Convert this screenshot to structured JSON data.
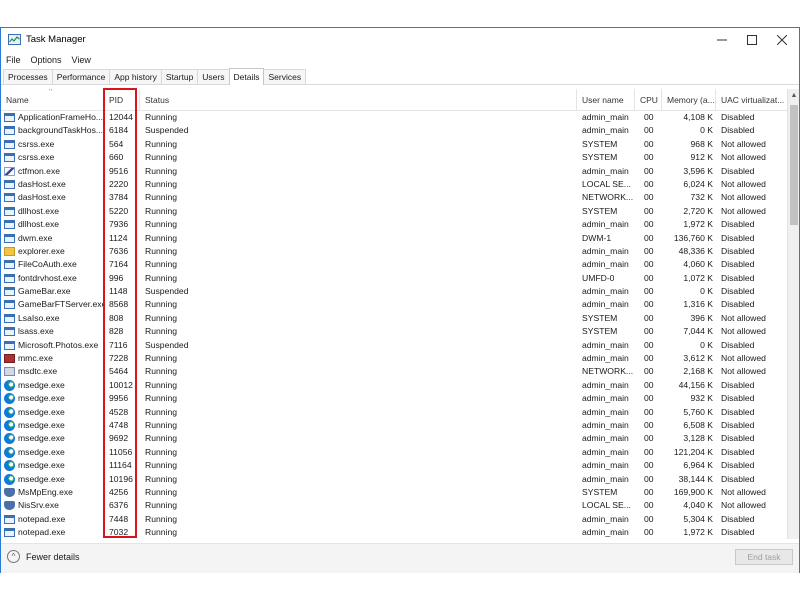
{
  "window": {
    "title": "Task Manager"
  },
  "menu": [
    "File",
    "Options",
    "View"
  ],
  "tabs": [
    "Processes",
    "Performance",
    "App history",
    "Startup",
    "Users",
    "Details",
    "Services"
  ],
  "active_tab": "Details",
  "columns": {
    "name": "Name",
    "pid": "PID",
    "status": "Status",
    "user": "User name",
    "cpu": "CPU",
    "memory": "Memory (a...",
    "uac": "UAC virtualizat..."
  },
  "rows": [
    {
      "name": "ApplicationFrameHo...",
      "pid": "12044",
      "status": "Running",
      "user": "admin_main",
      "cpu": "00",
      "memory": "4,108 K",
      "uac": "Disabled",
      "icon": "window-icon"
    },
    {
      "name": "backgroundTaskHos...",
      "pid": "6184",
      "status": "Suspended",
      "user": "admin_main",
      "cpu": "00",
      "memory": "0 K",
      "uac": "Disabled",
      "icon": "window-icon"
    },
    {
      "name": "csrss.exe",
      "pid": "564",
      "status": "Running",
      "user": "SYSTEM",
      "cpu": "00",
      "memory": "968 K",
      "uac": "Not allowed",
      "icon": "window-icon"
    },
    {
      "name": "csrss.exe",
      "pid": "660",
      "status": "Running",
      "user": "SYSTEM",
      "cpu": "00",
      "memory": "912 K",
      "uac": "Not allowed",
      "icon": "window-icon"
    },
    {
      "name": "ctfmon.exe",
      "pid": "9516",
      "status": "Running",
      "user": "admin_main",
      "cpu": "00",
      "memory": "3,596 K",
      "uac": "Disabled",
      "icon": "pen-icon"
    },
    {
      "name": "dasHost.exe",
      "pid": "2220",
      "status": "Running",
      "user": "LOCAL SE...",
      "cpu": "00",
      "memory": "6,024 K",
      "uac": "Not allowed",
      "icon": "window-icon"
    },
    {
      "name": "dasHost.exe",
      "pid": "3784",
      "status": "Running",
      "user": "NETWORK...",
      "cpu": "00",
      "memory": "732 K",
      "uac": "Not allowed",
      "icon": "window-icon"
    },
    {
      "name": "dllhost.exe",
      "pid": "5220",
      "status": "Running",
      "user": "SYSTEM",
      "cpu": "00",
      "memory": "2,720 K",
      "uac": "Not allowed",
      "icon": "window-icon"
    },
    {
      "name": "dllhost.exe",
      "pid": "7936",
      "status": "Running",
      "user": "admin_main",
      "cpu": "00",
      "memory": "1,972 K",
      "uac": "Disabled",
      "icon": "window-icon"
    },
    {
      "name": "dwm.exe",
      "pid": "1124",
      "status": "Running",
      "user": "DWM-1",
      "cpu": "00",
      "memory": "136,760 K",
      "uac": "Disabled",
      "icon": "window-icon"
    },
    {
      "name": "explorer.exe",
      "pid": "7636",
      "status": "Running",
      "user": "admin_main",
      "cpu": "00",
      "memory": "48,336 K",
      "uac": "Disabled",
      "icon": "folder-icon"
    },
    {
      "name": "FileCoAuth.exe",
      "pid": "7164",
      "status": "Running",
      "user": "admin_main",
      "cpu": "00",
      "memory": "4,060 K",
      "uac": "Disabled",
      "icon": "window-icon"
    },
    {
      "name": "fontdrvhost.exe",
      "pid": "996",
      "status": "Running",
      "user": "UMFD-0",
      "cpu": "00",
      "memory": "1,072 K",
      "uac": "Disabled",
      "icon": "window-icon"
    },
    {
      "name": "GameBar.exe",
      "pid": "1148",
      "status": "Suspended",
      "user": "admin_main",
      "cpu": "00",
      "memory": "0 K",
      "uac": "Disabled",
      "icon": "window-icon"
    },
    {
      "name": "GameBarFTServer.exe",
      "pid": "8568",
      "status": "Running",
      "user": "admin_main",
      "cpu": "00",
      "memory": "1,316 K",
      "uac": "Disabled",
      "icon": "window-icon"
    },
    {
      "name": "LsaIso.exe",
      "pid": "808",
      "status": "Running",
      "user": "SYSTEM",
      "cpu": "00",
      "memory": "396 K",
      "uac": "Not allowed",
      "icon": "window-icon"
    },
    {
      "name": "lsass.exe",
      "pid": "828",
      "status": "Running",
      "user": "SYSTEM",
      "cpu": "00",
      "memory": "7,044 K",
      "uac": "Not allowed",
      "icon": "window-icon"
    },
    {
      "name": "Microsoft.Photos.exe",
      "pid": "7116",
      "status": "Suspended",
      "user": "admin_main",
      "cpu": "00",
      "memory": "0 K",
      "uac": "Disabled",
      "icon": "window-icon"
    },
    {
      "name": "mmc.exe",
      "pid": "7228",
      "status": "Running",
      "user": "admin_main",
      "cpu": "00",
      "memory": "3,612 K",
      "uac": "Not allowed",
      "icon": "mmc-icon"
    },
    {
      "name": "msdtc.exe",
      "pid": "5464",
      "status": "Running",
      "user": "NETWORK...",
      "cpu": "00",
      "memory": "2,168 K",
      "uac": "Not allowed",
      "icon": "network-icon"
    },
    {
      "name": "msedge.exe",
      "pid": "10012",
      "status": "Running",
      "user": "admin_main",
      "cpu": "00",
      "memory": "44,156 K",
      "uac": "Disabled",
      "icon": "edge-icon"
    },
    {
      "name": "msedge.exe",
      "pid": "9956",
      "status": "Running",
      "user": "admin_main",
      "cpu": "00",
      "memory": "932 K",
      "uac": "Disabled",
      "icon": "edge-icon"
    },
    {
      "name": "msedge.exe",
      "pid": "4528",
      "status": "Running",
      "user": "admin_main",
      "cpu": "00",
      "memory": "5,760 K",
      "uac": "Disabled",
      "icon": "edge-icon"
    },
    {
      "name": "msedge.exe",
      "pid": "4748",
      "status": "Running",
      "user": "admin_main",
      "cpu": "00",
      "memory": "6,508 K",
      "uac": "Disabled",
      "icon": "edge-icon"
    },
    {
      "name": "msedge.exe",
      "pid": "9692",
      "status": "Running",
      "user": "admin_main",
      "cpu": "00",
      "memory": "3,128 K",
      "uac": "Disabled",
      "icon": "edge-icon"
    },
    {
      "name": "msedge.exe",
      "pid": "11056",
      "status": "Running",
      "user": "admin_main",
      "cpu": "00",
      "memory": "121,204 K",
      "uac": "Disabled",
      "icon": "edge-icon"
    },
    {
      "name": "msedge.exe",
      "pid": "11164",
      "status": "Running",
      "user": "admin_main",
      "cpu": "00",
      "memory": "6,964 K",
      "uac": "Disabled",
      "icon": "edge-icon"
    },
    {
      "name": "msedge.exe",
      "pid": "10196",
      "status": "Running",
      "user": "admin_main",
      "cpu": "00",
      "memory": "38,144 K",
      "uac": "Disabled",
      "icon": "edge-icon"
    },
    {
      "name": "MsMpEng.exe",
      "pid": "4256",
      "status": "Running",
      "user": "SYSTEM",
      "cpu": "00",
      "memory": "169,900 K",
      "uac": "Not allowed",
      "icon": "shield-icon"
    },
    {
      "name": "NisSrv.exe",
      "pid": "6376",
      "status": "Running",
      "user": "LOCAL SE...",
      "cpu": "00",
      "memory": "4,040 K",
      "uac": "Not allowed",
      "icon": "shield-icon"
    },
    {
      "name": "notepad.exe",
      "pid": "7448",
      "status": "Running",
      "user": "admin_main",
      "cpu": "00",
      "memory": "5,304 K",
      "uac": "Disabled",
      "icon": "window-icon"
    },
    {
      "name": "notepad.exe",
      "pid": "7032",
      "status": "Running",
      "user": "admin_main",
      "cpu": "00",
      "memory": "1,972 K",
      "uac": "Disabled",
      "icon": "window-icon"
    }
  ],
  "footer": {
    "fewer_details": "Fewer details",
    "end_task": "End task"
  },
  "colors": {
    "highlight": "#d7151c",
    "window_border": "#2b7bd6"
  }
}
